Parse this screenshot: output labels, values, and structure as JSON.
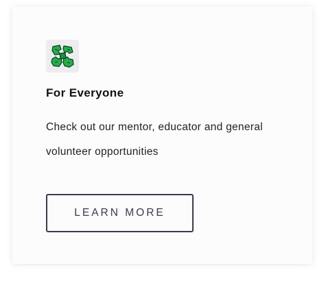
{
  "card": {
    "icon": "four-hands-icon",
    "title": "For Everyone",
    "description": "Check out our mentor, educator and general volunteer opportunities",
    "button_label": "LEARN MORE"
  },
  "colors": {
    "card_background": "#fcfcfd",
    "icon_tile_background": "#ededf0",
    "icon_green": "#22b04b",
    "button_border": "#3a3a4c",
    "title_text": "#111111",
    "body_text": "#222222"
  }
}
